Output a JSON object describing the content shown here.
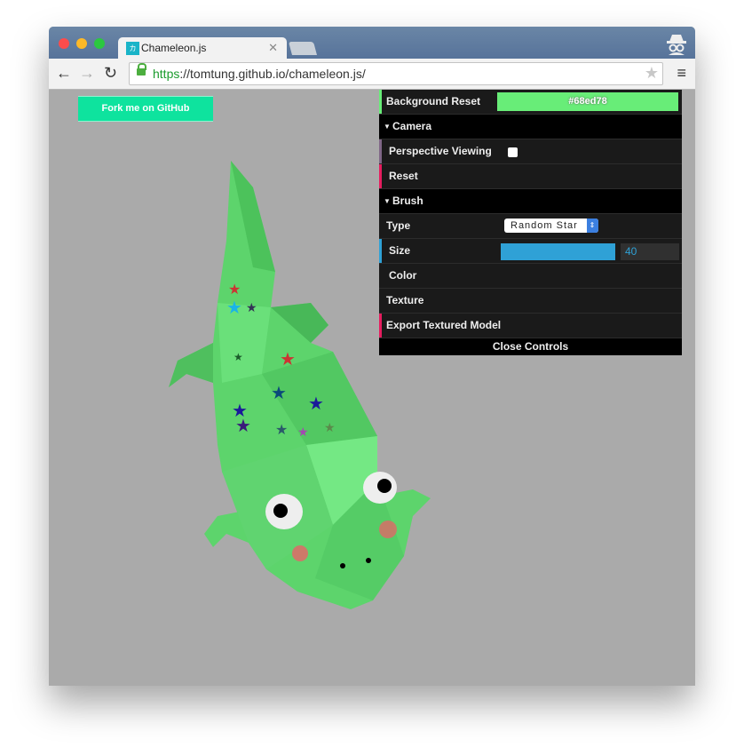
{
  "browser": {
    "tab_title": "Chameleon.js",
    "tab_favicon": "カメ",
    "url_scheme": "https",
    "url_rest": "://tomtung.github.io/chameleon.js/",
    "icons": [
      "back-arrow-icon",
      "forward-arrow-icon",
      "reload-icon",
      "lock-icon",
      "bookmark-star-icon",
      "menu-icon",
      "incognito-icon",
      "close-icon"
    ]
  },
  "page": {
    "fork_label": "Fork me on GitHub"
  },
  "controls": {
    "background_reset_label": "Background Reset",
    "background_color": "#68ed78",
    "camera": {
      "title": "Camera",
      "perspective_label": "Perspective Viewing",
      "perspective_checked": false,
      "reset_label": "Reset"
    },
    "brush": {
      "title": "Brush",
      "type_label": "Type",
      "type_value": "Random Star",
      "size_label": "Size",
      "size_value": "40",
      "size_fill_fraction": 1.0,
      "color_label": "Color",
      "texture_label": "Texture"
    },
    "export_label": "Export Textured Model",
    "close_label": "Close Controls"
  },
  "colors": {
    "accent_blue": "#2fa1d6",
    "fork_green": "#0ee39e",
    "canvas_bg": "#aaaaaa"
  }
}
